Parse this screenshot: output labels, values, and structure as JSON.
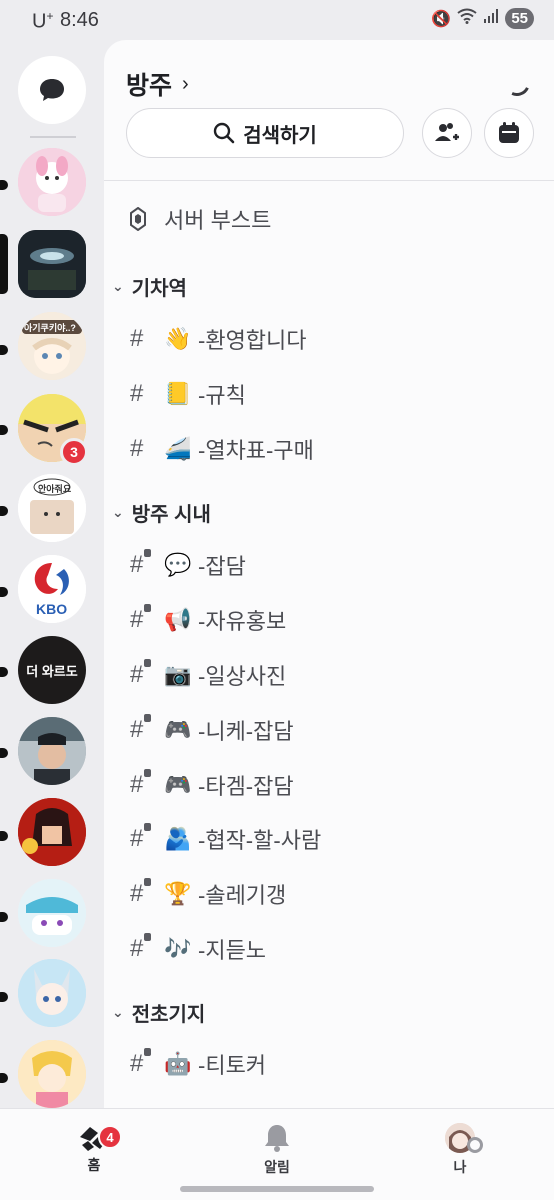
{
  "status": {
    "carrier": "U",
    "carrier_sup": "+",
    "time": "8:46",
    "battery": "55"
  },
  "rail": {
    "dm_icon": "chat-bubble-icon",
    "servers": [
      {
        "id": "s1",
        "label": "",
        "color": "#f4c6d8"
      },
      {
        "id": "s2",
        "label": "",
        "color": "#2e3a44"
      },
      {
        "id": "s3",
        "label": "아기쿠키야..?",
        "color": "#f3e6d6"
      },
      {
        "id": "s4",
        "label": "",
        "color": "#f2e25a",
        "badge": "3"
      },
      {
        "id": "s5",
        "label": "안아줘요",
        "color": "#ffffff"
      },
      {
        "id": "s6",
        "label": "KBO",
        "color": "#ffffff"
      },
      {
        "id": "s7",
        "label": "더 와르도",
        "color": "#1d1b1b"
      },
      {
        "id": "s8",
        "label": "",
        "color": "#9aa4ad"
      },
      {
        "id": "s9",
        "label": "",
        "color": "#c2221a"
      },
      {
        "id": "s10",
        "label": "",
        "color": "#e9f6fa"
      },
      {
        "id": "s11",
        "label": "",
        "color": "#bfe4f6"
      },
      {
        "id": "s12",
        "label": "",
        "color": "#fde3b7"
      }
    ]
  },
  "server": {
    "name": "방주",
    "search_label": "검색하기",
    "boost_label": "서버 부스트"
  },
  "categories": [
    {
      "name": "기차역",
      "channels": [
        {
          "emoji": "👋",
          "name": "-환영합니다",
          "locked": false
        },
        {
          "emoji": "📒",
          "name": "-규칙",
          "locked": false
        },
        {
          "emoji": "🚄",
          "name": "-열차표-구매",
          "locked": false
        }
      ]
    },
    {
      "name": "방주 시내",
      "channels": [
        {
          "emoji": "💬",
          "name": "-잡담",
          "locked": true
        },
        {
          "emoji": "📢",
          "name": "-자유홍보",
          "locked": true
        },
        {
          "emoji": "📷",
          "name": "-일상사진",
          "locked": true
        },
        {
          "emoji": "🎮",
          "name": "-니케-잡담",
          "locked": true
        },
        {
          "emoji": "🎮",
          "name": "-타겜-잡담",
          "locked": true
        },
        {
          "emoji": "🫂",
          "name": "-협작-할-사람",
          "locked": true
        },
        {
          "emoji": "🏆",
          "name": "-솔레기갱",
          "locked": true
        },
        {
          "emoji": "🎶",
          "name": "-지듣노",
          "locked": true
        }
      ]
    },
    {
      "name": "전초기지",
      "channels": [
        {
          "emoji": "🤖",
          "name": "-티토커",
          "locked": true
        }
      ]
    }
  ],
  "nav": {
    "home_label": "홈",
    "home_badge": "4",
    "alerts_label": "알림",
    "me_label": "나"
  }
}
